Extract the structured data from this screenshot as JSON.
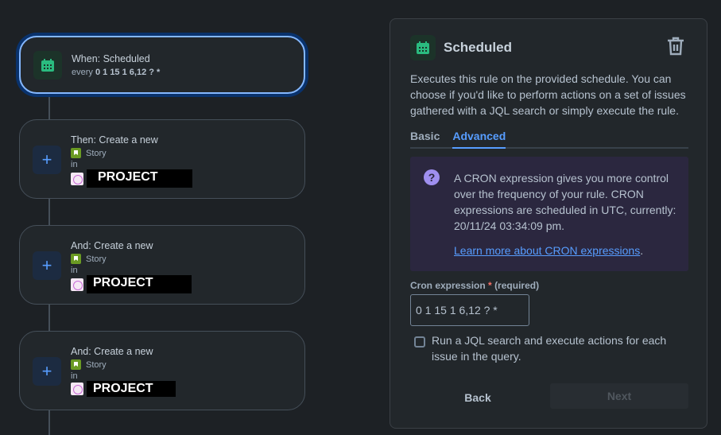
{
  "flow": {
    "trigger": {
      "title": "When: Scheduled",
      "every_label": "every",
      "cron": "0 1 15 1 6,12 ? *"
    },
    "actions": [
      {
        "title": "Then: Create a new",
        "issue_type": "Story",
        "in": "in",
        "project": "PROJECT"
      },
      {
        "title": "And: Create a new",
        "issue_type": "Story",
        "in": "in",
        "project": "PROJECT"
      },
      {
        "title": "And: Create a new",
        "issue_type": "Story",
        "in": "in",
        "project": "PROJECT"
      }
    ]
  },
  "panel": {
    "title": "Scheduled",
    "description": "Executes this rule on the provided schedule. You can choose if you'd like to perform actions on a set of issues gathered with a JQL search or simply execute the rule.",
    "tabs": [
      {
        "label": "Basic"
      },
      {
        "label": "Advanced"
      }
    ],
    "info": {
      "text": "A CRON expression gives you more control over the frequency of your rule. CRON expressions are scheduled in UTC, currently: 20/11/24 03:34:09 pm.",
      "link": "Learn more about CRON expressions",
      "link_suffix": "."
    },
    "field": {
      "label": "Cron expression",
      "asterisk": "*",
      "required": "(required)",
      "value": "0 1 15 1 6,12 ? *"
    },
    "checkbox": {
      "label": "Run a JQL search and execute actions for each issue in the query.",
      "checked": false
    },
    "back": "Back",
    "next": "Next"
  }
}
